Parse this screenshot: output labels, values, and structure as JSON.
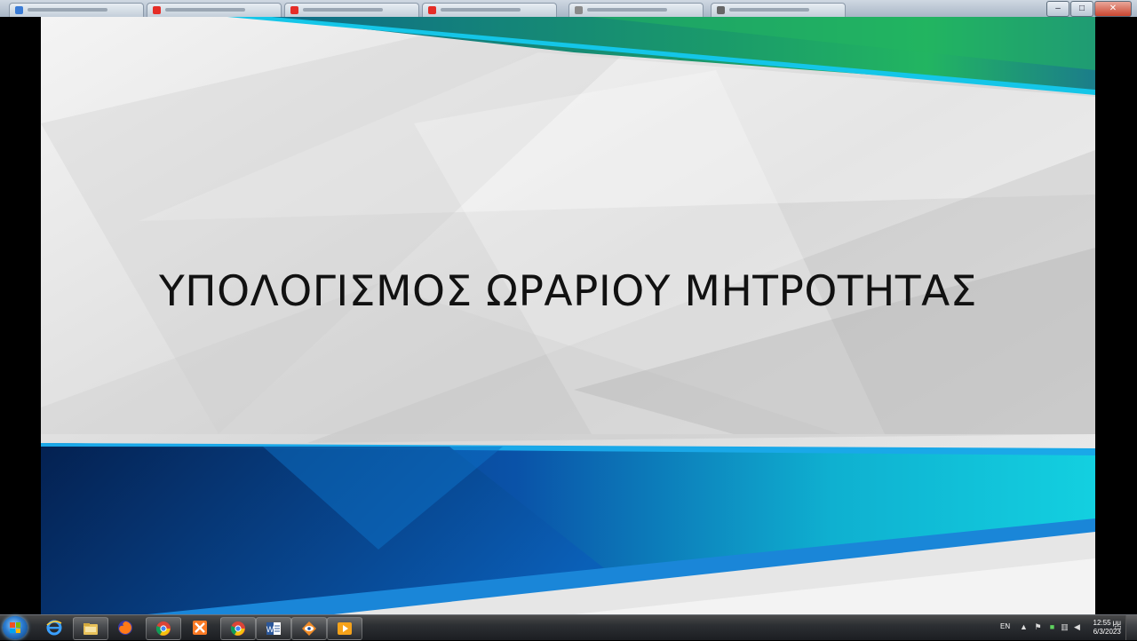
{
  "browser": {
    "tabs": [
      {
        "favicon_color": "#3a7bd5"
      },
      {
        "favicon_color": "#e52d27"
      },
      {
        "favicon_color": "#e52d27"
      },
      {
        "favicon_color": "#e52d27"
      },
      {
        "favicon_color": "#8a8a8a"
      },
      {
        "favicon_color": "#666666"
      }
    ],
    "window_buttons": {
      "minimize": "–",
      "maximize": "□",
      "close": "✕"
    }
  },
  "slide": {
    "title": "ΥΠΟΛΟΓΙΣΜΟΣ ΩΡΑΡΙΟΥ ΜΗΤΡΟΤΗΤΑΣ",
    "colors": {
      "background": "#e8e8e8",
      "green": "#22b561",
      "cyan": "#13d0e0",
      "blue": "#0a52a8",
      "navy": "#062a63",
      "title": "#111111"
    }
  },
  "taskbar": {
    "items": [
      {
        "name": "internet-explorer-icon",
        "pinned": false
      },
      {
        "name": "folder-icon",
        "pinned": true
      },
      {
        "name": "firefox-icon",
        "pinned": false
      },
      {
        "name": "chrome-icon",
        "pinned": true
      },
      {
        "name": "xampp-icon",
        "pinned": false
      },
      {
        "name": "chrome-icon",
        "pinned": true
      },
      {
        "name": "word-icon",
        "pinned": true
      },
      {
        "name": "eye-app-icon",
        "pinned": true
      },
      {
        "name": "media-player-icon",
        "pinned": true
      }
    ],
    "tray": {
      "language": "EN",
      "time": "12:55 μμ",
      "date": "6/3/2023"
    }
  }
}
